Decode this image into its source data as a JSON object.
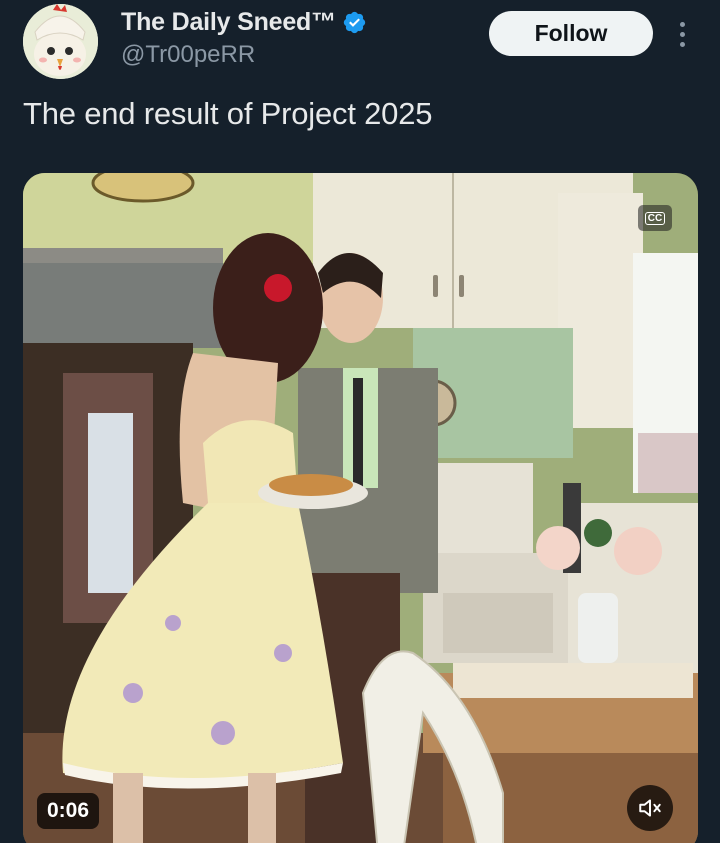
{
  "author": {
    "display_name": "The Daily Sneed™",
    "handle": "@Tr00peRR",
    "verified": true,
    "avatar": "cat-in-chicken-hat-avatar"
  },
  "actions": {
    "follow_label": "Follow",
    "more_icon": "more-vertical-icon"
  },
  "tweet": {
    "text": "The end result of Project 2025"
  },
  "media": {
    "type": "video",
    "description_icon": "video-still",
    "timer": "0:06",
    "captions_label": "CC",
    "mute_icon": "speaker-muted-icon"
  },
  "colors": {
    "background": "#15202b",
    "primary_text": "#e7e9ea",
    "secondary_text": "#8b98a5",
    "verified_badge": "#1d9bf0",
    "follow_button_bg": "#eff3f4"
  }
}
